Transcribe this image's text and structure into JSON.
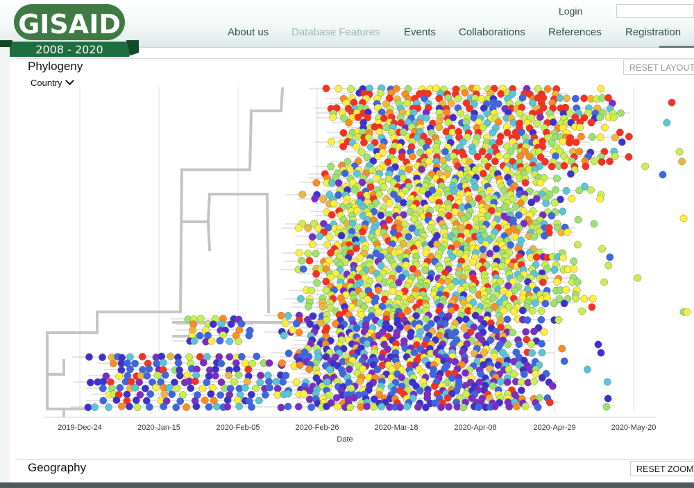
{
  "header": {
    "logo_text": "GISAID",
    "logo_years": "2008 - 2020",
    "login_label": "Login",
    "nav": [
      {
        "label": "About us",
        "active": false
      },
      {
        "label": "Database Features",
        "active": true
      },
      {
        "label": "Events",
        "active": false
      },
      {
        "label": "Collaborations",
        "active": false
      },
      {
        "label": "References",
        "active": false
      },
      {
        "label": "Registration",
        "active": false
      }
    ]
  },
  "phylogeny": {
    "title": "Phylogeny",
    "reset_label": "RESET LAYOUT",
    "color_by": "Country",
    "axis": {
      "title": "Date",
      "ticks": [
        "2019-Dec-24",
        "2020-Jan-15",
        "2020-Feb-05",
        "2020-Feb-26",
        "2020-Mar-18",
        "2020-Apr-08",
        "2020-Apr-29",
        "2020-May-20"
      ]
    },
    "palette": [
      "#ff2f1f",
      "#ffef3a",
      "#c8ef4d",
      "#9be36b",
      "#58c6d6",
      "#3c66e4",
      "#3e2fd0",
      "#7c2cc4",
      "#ff8c1e",
      "#f0b63a"
    ],
    "colors": {
      "branch": "#c4c4c4",
      "grid": "#e8e8e8"
    }
  },
  "geography": {
    "title": "Geography",
    "reset_label": "RESET ZOOM"
  }
}
